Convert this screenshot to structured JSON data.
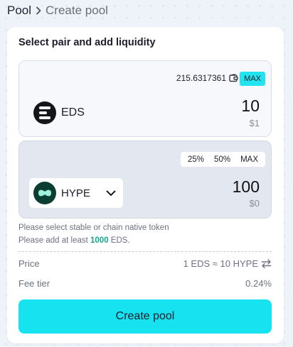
{
  "breadcrumb": {
    "root": "Pool",
    "current": "Create pool",
    "separator_icon": "chevron-right-icon"
  },
  "card": {
    "title": "Select pair and add liquidity"
  },
  "token_a": {
    "symbol": "EDS",
    "icon": "eds-logo-icon",
    "balance": "215.6317361",
    "balance_icon": "wallet-icon",
    "max_label": "MAX",
    "amount": "10",
    "usd_value": "$1"
  },
  "token_b": {
    "symbol": "HYPE",
    "icon": "hype-logo-icon",
    "select_icon": "chevron-down-icon",
    "percent_buttons": [
      "25%",
      "50%",
      "MAX"
    ],
    "amount": "100",
    "usd_value": "$0"
  },
  "notes": {
    "line1": "Please select stable or chain native token",
    "line2_prefix": "Please add at least ",
    "line2_amount": "1000",
    "line2_suffix": " EDS."
  },
  "summary": {
    "price_label": "Price",
    "price_value": "1 EDS ≈ 10 HYPE",
    "price_icon": "swap-arrows-icon",
    "fee_label": "Fee tier",
    "fee_value": "0.24%"
  },
  "actions": {
    "create_label": "Create pool"
  },
  "colors": {
    "accent": "#17e2f0",
    "highlight": "#14a594",
    "hype_logo": "#0c3d33"
  }
}
